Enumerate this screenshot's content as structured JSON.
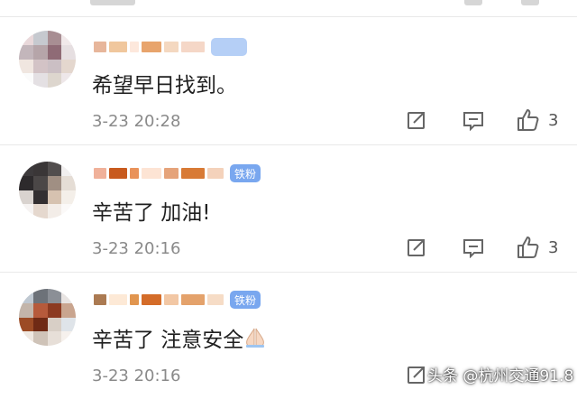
{
  "comments": [
    {
      "text": "希望早日找到。",
      "time": "3-23 20:28",
      "likes": "3",
      "badge": "",
      "avatar_colors": [
        "#e9d8da",
        "#c6c9cf",
        "#a88e93",
        "#f1e9ea",
        "#c3b6bb",
        "#b6a5a9",
        "#8f6b76",
        "#e6dfe1",
        "#f0e6e0",
        "#d3c3c6",
        "#cbbfc4",
        "#e4d7ce",
        "#fbfbfb",
        "#e4e0e3",
        "#ddd6ce",
        "#eee7e9"
      ],
      "name_colors": [
        "#e7b69b",
        "#f0c79d",
        "#fde8dc",
        "#e8a46c",
        "#f4d8c0",
        "#f5d7c7"
      ]
    },
    {
      "text": "辛苦了 加油!",
      "time": "3-23 20:16",
      "likes": "3",
      "badge": "铁粉",
      "avatar_colors": [
        "#3d3a3c",
        "#3a3637",
        "#524e4e",
        "#f1efef",
        "#2d2a2c",
        "#4b4747",
        "#a08f83",
        "#e5ddd5",
        "#d9d3cf",
        "#332f31",
        "#d6c2b0",
        "#f4efe9",
        "#f6f3f2",
        "#e5d8ce",
        "#f3ede8",
        "#fbf9f8"
      ],
      "name_colors": [
        "#f0b19a",
        "#c85a1e",
        "#e9925a",
        "#fde4d4",
        "#e5a37a",
        "#d87a35",
        "#f4d2bb"
      ]
    },
    {
      "text": "辛苦了 注意安全",
      "time": "3-23 20:16",
      "likes": "3",
      "badge": "铁粉",
      "avatar_colors": [
        "#bfc8d1",
        "#6d7279",
        "#8b8f96",
        "#e8e4e2",
        "#c3b5aa",
        "#b65a3b",
        "#8c3a21",
        "#c9a58f",
        "#9c4b25",
        "#6f2a15",
        "#d8cfc6",
        "#dfe4e9",
        "#efe8e1",
        "#cfc3b8",
        "#e7dfd8",
        "#f6f1ed"
      ],
      "name_colors": [
        "#ab7a52",
        "#fde9d6",
        "#e1954f",
        "#d46c29",
        "#f2c7a4",
        "#e4a26b",
        "#f6dcc6"
      ]
    }
  ],
  "watermark": "头条 @杭州交通91.8",
  "colors": {
    "badge_bg": "#79a7ef",
    "text": "#1f1f1f",
    "meta": "#8a8a8a",
    "icon": "#666666"
  }
}
